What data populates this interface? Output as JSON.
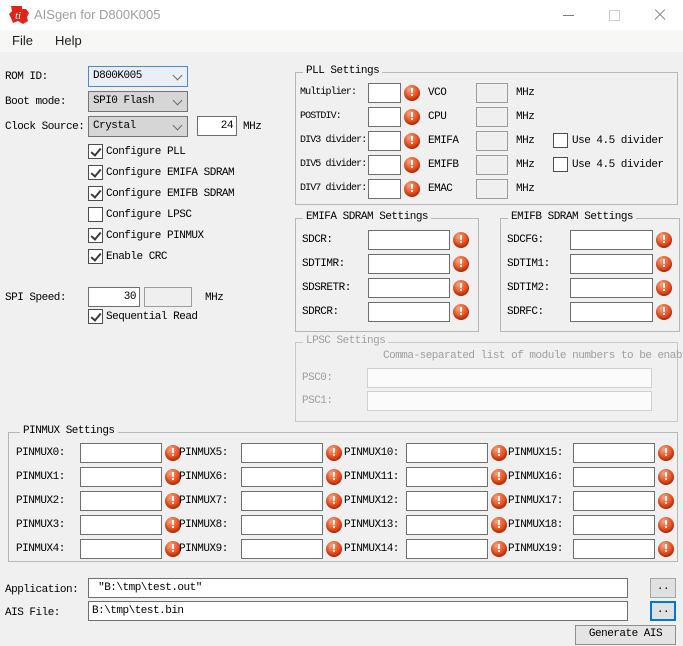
{
  "colors": {
    "accent": "#0078d7",
    "ti_red": "#e2231a",
    "error_icon": "#dd3f12",
    "window_bg": "#f0f0f0"
  },
  "window": {
    "title": "AISgen for D800K005"
  },
  "menu": {
    "file": "File",
    "help": "Help"
  },
  "left": {
    "rom_id_label": "ROM ID:",
    "rom_id_value": "D800K005",
    "boot_mode_label": "Boot mode:",
    "boot_mode_value": "SPI0 Flash",
    "clock_label": "Clock Source:",
    "clock_value": "Crystal",
    "clock_freq": "24",
    "clock_unit": "MHz",
    "checks": [
      {
        "label": "Configure PLL",
        "checked": true
      },
      {
        "label": "Configure EMIFA SDRAM",
        "checked": true
      },
      {
        "label": "Configure EMIFB SDRAM",
        "checked": true
      },
      {
        "label": "Configure LPSC",
        "checked": false
      },
      {
        "label": "Configure PINMUX",
        "checked": true
      },
      {
        "label": "Enable CRC",
        "checked": true
      }
    ],
    "spi_label": "SPI Speed:",
    "spi_value": "30",
    "spi_unit": "MHz",
    "seq_read": {
      "label": "Sequential Read",
      "checked": true
    }
  },
  "pll": {
    "title": "PLL Settings",
    "rows": [
      {
        "label": "Multiplier:",
        "out": "VCO",
        "unit": "MHz"
      },
      {
        "label": "POSTDIV:",
        "out": "CPU",
        "unit": "MHz"
      },
      {
        "label": "DIV3 divider:",
        "out": "EMIFA",
        "unit": "MHz",
        "divider": "Use 4.5 divider",
        "divider_checked": false
      },
      {
        "label": "DIV5 divider:",
        "out": "EMIFB",
        "unit": "MHz",
        "divider": "Use 4.5 divider",
        "divider_checked": false
      },
      {
        "label": "DIV7 divider:",
        "out": "EMAC",
        "unit": "MHz"
      }
    ]
  },
  "emifa": {
    "title": "EMIFA SDRAM Settings",
    "fields": [
      "SDCR:",
      "SDTIMR:",
      "SDSRETR:",
      "SDRCR:"
    ]
  },
  "emifb": {
    "title": "EMIFB SDRAM Settings",
    "fields": [
      "SDCFG:",
      "SDTIM1:",
      "SDTIM2:",
      "SDRFC:"
    ]
  },
  "lpsc": {
    "title": "LPSC Settings",
    "hint": "Comma-separated list of module numbers to be enab",
    "fields": [
      "PSC0:",
      "PSC1:"
    ]
  },
  "pinmux": {
    "title": "PINMUX Settings",
    "fields": [
      "PINMUX0:",
      "PINMUX1:",
      "PINMUX2:",
      "PINMUX3:",
      "PINMUX4:",
      "PINMUX5:",
      "PINMUX6:",
      "PINMUX7:",
      "PINMUX8:",
      "PINMUX9:",
      "PINMUX10:",
      "PINMUX11:",
      "PINMUX12:",
      "PINMUX13:",
      "PINMUX14:",
      "PINMUX15:",
      "PINMUX16:",
      "PINMUX17:",
      "PINMUX18:",
      "PINMUX19:"
    ]
  },
  "footer": {
    "application_label": "Application:",
    "application_value": " \"B:\\tmp\\test.out\"",
    "ais_label": "AIS File:",
    "ais_value": "B:\\tmp\\test.bin",
    "browse_label": "..",
    "generate_label": "Generate AIS"
  }
}
